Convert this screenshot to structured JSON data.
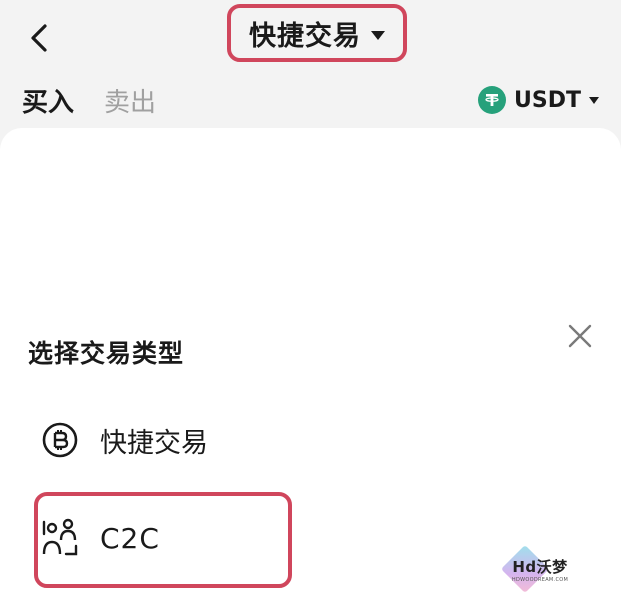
{
  "header": {
    "title": "快捷交易"
  },
  "tabs": [
    {
      "label": "买入",
      "active": true
    },
    {
      "label": "卖出",
      "active": false
    }
  ],
  "currency": {
    "label": "USDT",
    "icon_color": "#26a17b"
  },
  "sheet": {
    "title": "选择交易类型",
    "options": [
      {
        "label": "快捷交易",
        "icon": "bitcoin-circle-icon"
      },
      {
        "label": "C2C",
        "icon": "c2c-users-icon"
      }
    ]
  },
  "watermark": {
    "text": "Hd沃梦",
    "subtext": "HDWOODREAM.COM"
  },
  "colors": {
    "highlight": "#d0465c",
    "text": "#1a1a1a",
    "muted": "#a0a0a0",
    "background": "#f3f3f3",
    "sheet": "#ffffff"
  }
}
